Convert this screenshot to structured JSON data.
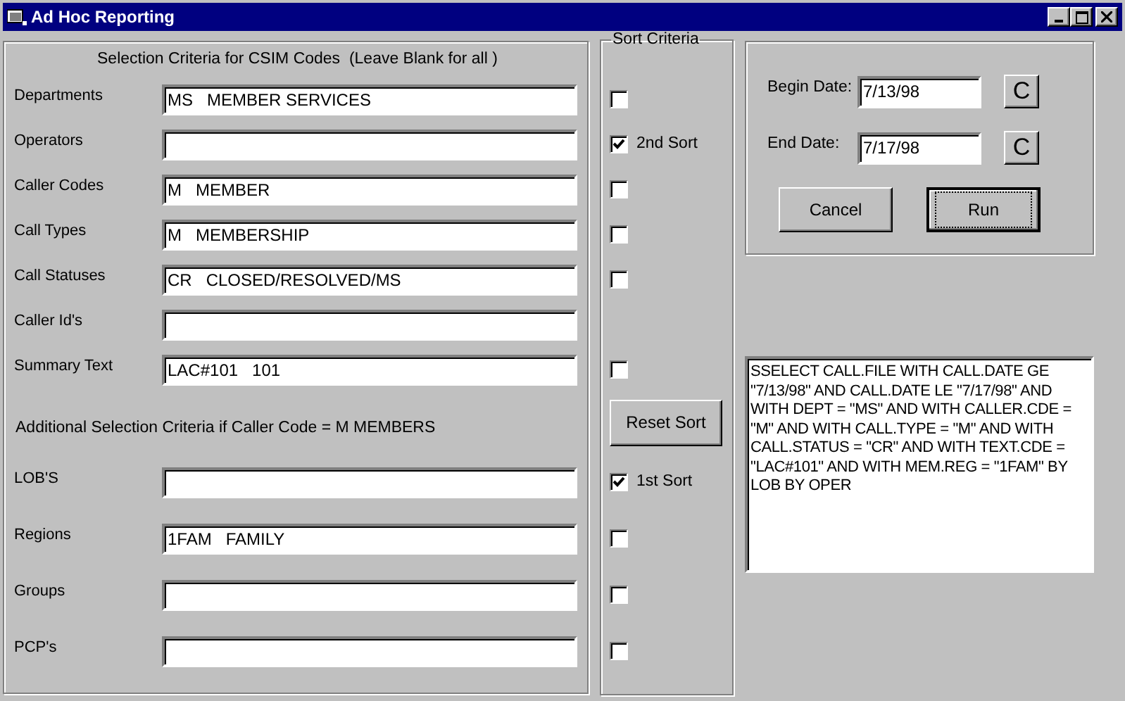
{
  "window": {
    "title": "Ad Hoc Reporting"
  },
  "selection_criteria": {
    "title": "Selection Criteria for CSIM Codes  (Leave Blank for all )",
    "rows": [
      {
        "label": "Departments",
        "value": "MS   MEMBER SERVICES",
        "sort": {
          "checked": false
        }
      },
      {
        "label": "Operators",
        "sort": {
          "checked": true,
          "label": "2nd Sort"
        }
      },
      {
        "label": "Caller Codes",
        "value": "M   MEMBER",
        "sort": {
          "checked": false
        }
      },
      {
        "label": "Call Types",
        "value": "M   MEMBERSHIP",
        "sort": {
          "checked": false
        }
      },
      {
        "label": "Call Statuses",
        "value": "CR   CLOSED/RESOLVED/MS",
        "sort": {
          "checked": false
        }
      },
      {
        "label": "Caller Id's"
      },
      {
        "label": "Summary Text",
        "value": "LAC#101   101",
        "sort": {
          "checked": false
        }
      }
    ]
  },
  "additional_criteria": {
    "title": "Additional Selection Criteria if Caller Code = M MEMBERS",
    "rows": [
      {
        "label": "LOB'S",
        "sort": {
          "checked": true,
          "label": "1st Sort"
        }
      },
      {
        "label": "Regions",
        "value": "1FAM   FAMILY",
        "sort": {
          "checked": false
        }
      },
      {
        "label": "Groups",
        "sort": {
          "checked": false
        }
      },
      {
        "label": "PCP's",
        "sort": {
          "checked": false
        }
      }
    ]
  },
  "sort_criteria": {
    "title": "Sort Criteria",
    "reset_button": "Reset Sort"
  },
  "dates": [
    {
      "label": "Begin Date:",
      "value": "7/13/98",
      "button": "C"
    },
    {
      "label": "End Date:",
      "value": "7/17/98",
      "button": "C"
    }
  ],
  "buttons": [
    {
      "label": "Cancel",
      "default": false
    },
    {
      "label": "Run",
      "default": true
    }
  ],
  "query": "SSELECT CALL.FILE WITH CALL.DATE GE \"7/13/98\" AND CALL.DATE LE \"7/17/98\" AND WITH DEPT = \"MS\" AND WITH CALLER.CDE = \"M\" AND WITH CALL.TYPE = \"M\" AND WITH CALL.STATUS = \"CR\" AND WITH TEXT.CDE = \"LAC#101\" AND WITH MEM.REG = \"1FAM\" BY LOB BY OPER"
}
